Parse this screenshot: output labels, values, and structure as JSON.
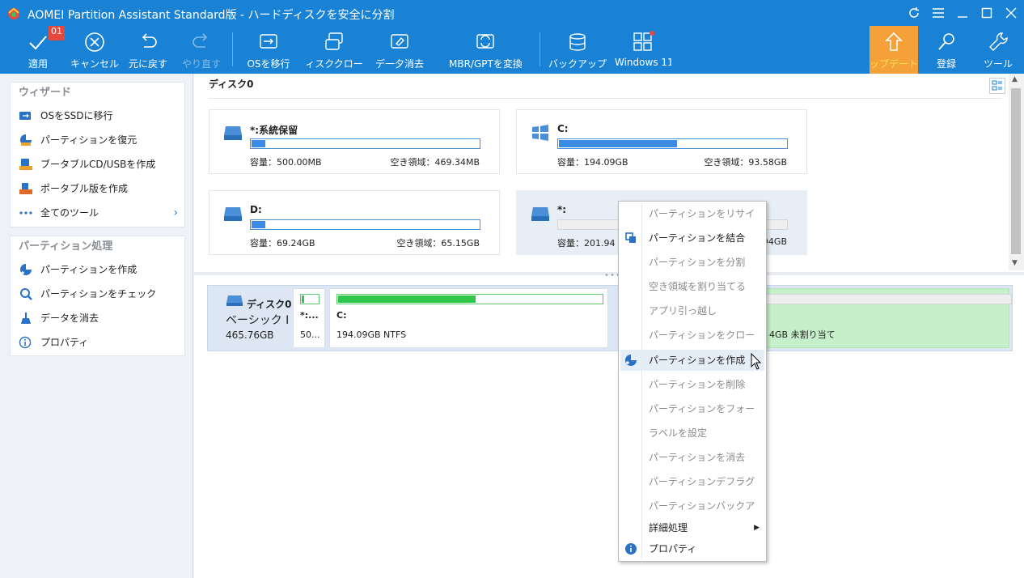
{
  "window": {
    "title": "AOMEI Partition Assistant Standard版 - ハードディスクを安全に分割",
    "accent": "#1a82d4"
  },
  "toolbar": {
    "badge": "01",
    "apply": "適用",
    "cancel": "キャンセル",
    "undo": "元に戻す",
    "redo": "やり直す",
    "migrate_os": "OSを移行",
    "disk_clone": "ィスククロー",
    "wipe": "デ一夕消去",
    "mbr_gpt": "MBR/GPTを変換",
    "backup": "バックアップ",
    "win11": "Windows 11",
    "upgrade": "ップデート",
    "register": "登録",
    "tools": "ツール"
  },
  "sidebar": {
    "wizard_title": "ウィザード",
    "wizard_items": [
      {
        "label": "OSをSSDに移行",
        "icon": "disk-migrate-icon"
      },
      {
        "label": "パーティションを復元",
        "icon": "partition-recover-icon"
      },
      {
        "label": "ブータブルCD/USBを作成",
        "icon": "bootable-media-icon"
      },
      {
        "label": "ポータブル版を作成",
        "icon": "portable-icon"
      },
      {
        "label": "全てのツール",
        "icon": "more-dots-icon"
      }
    ],
    "ops_title": "パーティション処理",
    "ops_items": [
      {
        "label": "パーティションを作成",
        "icon": "create-partition-icon"
      },
      {
        "label": "パーティションをチェック",
        "icon": "check-icon"
      },
      {
        "label": "データを消去",
        "icon": "broom-icon"
      },
      {
        "label": "プロパティ",
        "icon": "info-icon"
      }
    ]
  },
  "main": {
    "disk_title": "ディスク0",
    "cards": [
      {
        "name": "*:系統保留",
        "capacity": "容量：500.00MB",
        "free": "空き領域：469.34MB",
        "used_fraction": 0.06
      },
      {
        "name": "C:",
        "capacity": "容量：194.09GB",
        "free": "空き領域：93.58GB",
        "used_fraction": 0.52
      },
      {
        "name": "D:",
        "capacity": "容量：69.24GB",
        "free": "空き領域：65.15GB",
        "used_fraction": 0.06
      },
      {
        "name": "*:",
        "capacity": "容量：201.94",
        "free": "94GB",
        "used_fraction": 0
      }
    ],
    "diskmap": {
      "name": "ディスク0",
      "type": "ベーシック I",
      "size": "465.76GB",
      "partitions": [
        {
          "name": "*:...",
          "detail": "50...",
          "used_fraction": 0.15
        },
        {
          "name": "C:",
          "detail": "194.09GB NTFS",
          "used_fraction": 0.52
        }
      ],
      "unallocated": "4GB 未割り当て"
    }
  },
  "context_menu": {
    "items": [
      {
        "label": "パーティションをリサイ",
        "enabled": false
      },
      {
        "label": "パーティションを結合",
        "enabled": true,
        "icon": "merge-icon"
      },
      {
        "label": "パーティションを分割",
        "enabled": false
      },
      {
        "label": "空き領域を割り当てる",
        "enabled": false
      },
      {
        "label": "アプリ引っ越し",
        "enabled": false
      },
      {
        "label": "パーティションをクロー",
        "enabled": false
      },
      {
        "label": "パーティションを作成",
        "enabled": true,
        "icon": "create-partition-icon",
        "highlighted": true
      },
      {
        "label": "パーティションを削除",
        "enabled": false
      },
      {
        "label": "パーティションをフォー",
        "enabled": false
      },
      {
        "label": "ラベルを設定",
        "enabled": false
      },
      {
        "label": "パーティションを消去",
        "enabled": false
      },
      {
        "label": "パーティションデフラグ",
        "enabled": false
      },
      {
        "label": "パーティションバックア",
        "enabled": false
      },
      {
        "label": "詳細処理",
        "enabled": true,
        "submenu": true
      },
      {
        "label": "プロパティ",
        "enabled": true,
        "icon": "info-icon"
      }
    ]
  }
}
